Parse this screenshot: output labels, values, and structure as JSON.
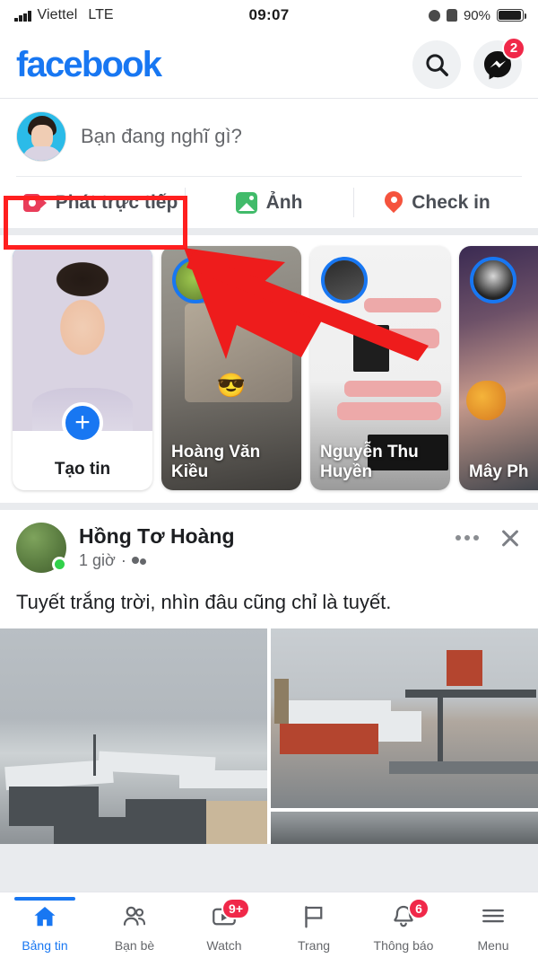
{
  "status_bar": {
    "carrier": "Viettel",
    "network": "LTE",
    "time": "09:07",
    "battery_percent": "90%"
  },
  "header": {
    "logo_text": "facebook",
    "search_icon": "search-icon",
    "messenger_icon": "messenger-icon",
    "messenger_badge": "2"
  },
  "composer": {
    "placeholder": "Bạn đang nghĩ gì?",
    "actions": [
      {
        "label": "Phát trực tiếp",
        "icon": "live-video-icon",
        "highlighted": true
      },
      {
        "label": "Ảnh",
        "icon": "photo-icon",
        "highlighted": false
      },
      {
        "label": "Check in",
        "icon": "location-pin-icon",
        "highlighted": false
      }
    ]
  },
  "stories": {
    "create": {
      "label": "Tạo tin",
      "icon": "plus-icon"
    },
    "items": [
      {
        "name": "Hoàng Văn Kiều"
      },
      {
        "name": "Nguyễn Thu Huyền"
      },
      {
        "name": "Mây Ph"
      }
    ]
  },
  "post": {
    "author": "Hồng Tơ Hoàng",
    "time": "1 giờ",
    "audience_icon": "friends-icon",
    "separator": "·",
    "menu_icon": "more-options-icon",
    "close_icon": "close-icon",
    "text": "Tuyết trắng trời, nhìn đâu cũng chỉ là tuyết."
  },
  "bottom_nav": [
    {
      "label": "Bảng tin",
      "icon": "home-icon",
      "active": true,
      "badge": ""
    },
    {
      "label": "Bạn bè",
      "icon": "friends-icon",
      "active": false,
      "badge": ""
    },
    {
      "label": "Watch",
      "icon": "watch-icon",
      "active": false,
      "badge": "9+"
    },
    {
      "label": "Trang",
      "icon": "pages-flag-icon",
      "active": false,
      "badge": ""
    },
    {
      "label": "Thông báo",
      "icon": "bell-icon",
      "active": false,
      "badge": "6"
    },
    {
      "label": "Menu",
      "icon": "hamburger-menu-icon",
      "active": false,
      "badge": ""
    }
  ],
  "annotation": {
    "highlight_target": "Phát trực tiếp",
    "highlight_color": "#ff1f1f",
    "arrow_color": "#ee1c1c"
  },
  "colors": {
    "brand_blue": "#1877F2",
    "badge_red": "#f02849",
    "live_red": "#e93d5a",
    "photo_green": "#41bb6a",
    "pin_red": "#f5533d"
  }
}
